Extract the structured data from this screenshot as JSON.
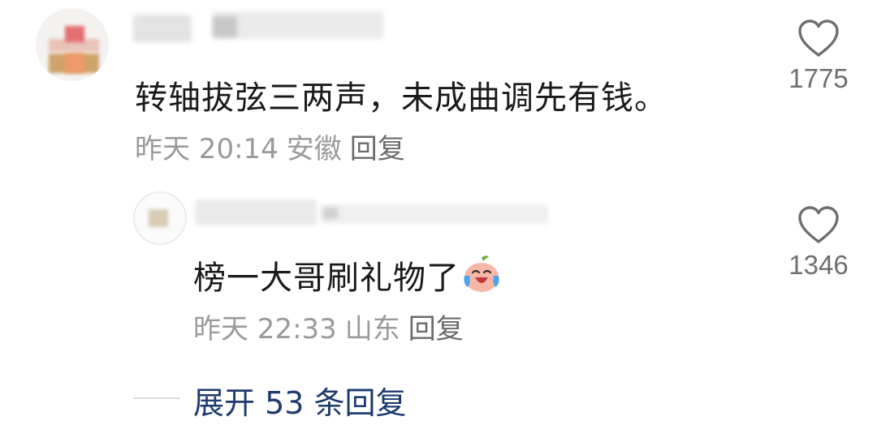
{
  "comment": {
    "text": "转轴拔弦三两声，未成曲调先有钱。",
    "time": "昨天 20:14",
    "location": "安徽",
    "reply_label": "回复",
    "likes": "1775"
  },
  "reply": {
    "text": "榜一大哥刷礼物了",
    "emoji": "crying-laughing-face",
    "time": "昨天 22:33",
    "location": "山东",
    "reply_label": "回复",
    "likes": "1346"
  },
  "expand": {
    "label": "展开 53 条回复"
  },
  "icons": {
    "like": "heart-outline-icon"
  },
  "colors": {
    "primary_text": "#1a1a1a",
    "meta_text": "#9a9a9a",
    "link": "#1e3a6e"
  }
}
